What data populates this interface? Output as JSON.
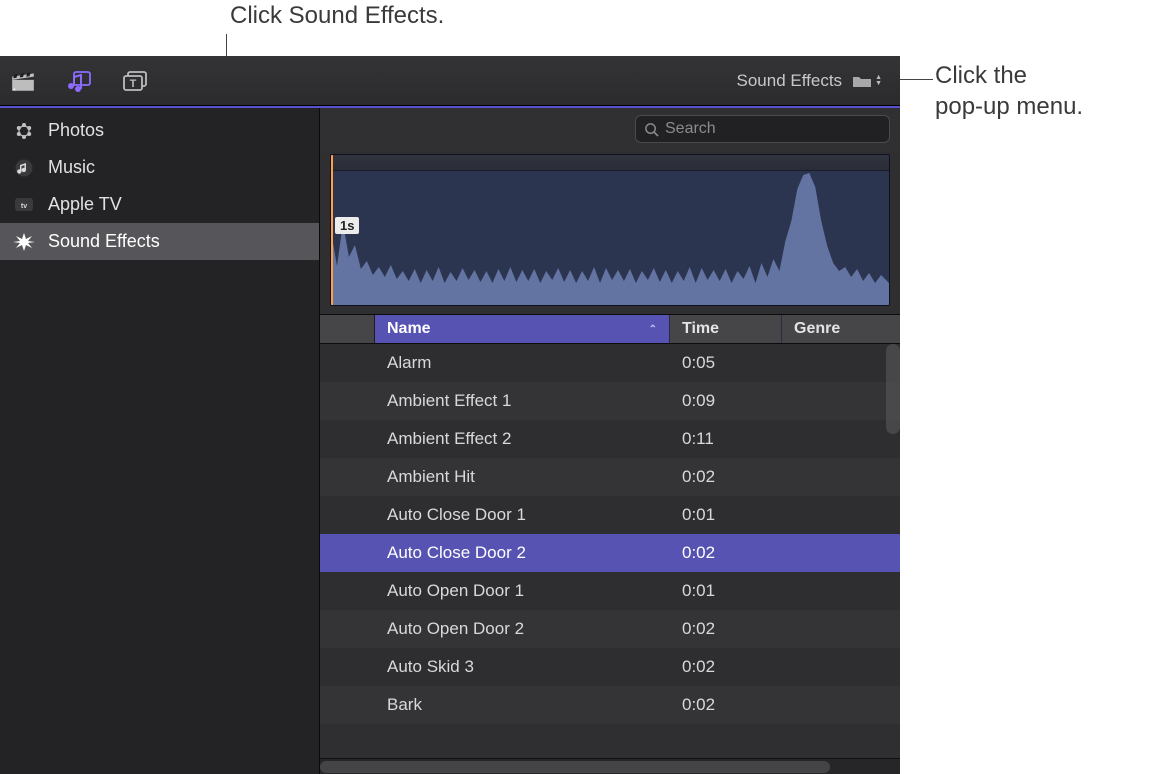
{
  "callouts": {
    "top": "Click Sound Effects.",
    "right_line1": "Click the",
    "right_line2": "pop-up menu."
  },
  "toolbar": {
    "popup_label": "Sound Effects"
  },
  "search": {
    "placeholder": "Search"
  },
  "sidebar": {
    "items": [
      {
        "label": "Photos",
        "icon": "photos"
      },
      {
        "label": "Music",
        "icon": "music"
      },
      {
        "label": "Apple TV",
        "icon": "appletv"
      },
      {
        "label": "Sound Effects",
        "icon": "burst"
      }
    ],
    "selected_index": 3
  },
  "waveform": {
    "time_flag": "1s"
  },
  "table": {
    "columns": {
      "gutter": "",
      "name": "Name",
      "time": "Time",
      "genre": "Genre"
    },
    "sort_column": "name",
    "selected_index": 5,
    "rows": [
      {
        "name": "Alarm",
        "time": "0:05",
        "genre": ""
      },
      {
        "name": "Ambient Effect 1",
        "time": "0:09",
        "genre": ""
      },
      {
        "name": "Ambient Effect 2",
        "time": "0:11",
        "genre": ""
      },
      {
        "name": "Ambient Hit",
        "time": "0:02",
        "genre": ""
      },
      {
        "name": "Auto Close Door 1",
        "time": "0:01",
        "genre": ""
      },
      {
        "name": "Auto Close Door 2",
        "time": "0:02",
        "genre": ""
      },
      {
        "name": "Auto Open Door 1",
        "time": "0:01",
        "genre": ""
      },
      {
        "name": "Auto Open Door 2",
        "time": "0:02",
        "genre": ""
      },
      {
        "name": "Auto Skid 3",
        "time": "0:02",
        "genre": ""
      },
      {
        "name": "Bark",
        "time": "0:02",
        "genre": ""
      }
    ]
  }
}
